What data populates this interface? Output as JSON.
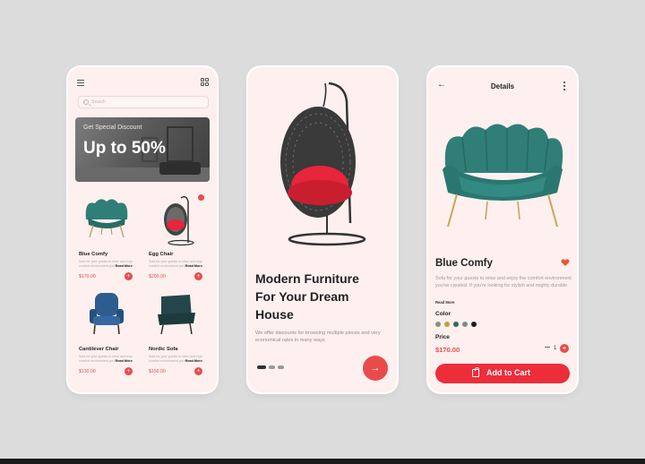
{
  "screen1": {
    "search": {
      "placeholder": "Search"
    },
    "banner": {
      "subtitle": "Get Special Discount",
      "headline": "Up to 50%"
    },
    "products": [
      {
        "name": "Blue Comfy",
        "desc_line1": "Sofa for your guests to relax and enjoy",
        "desc_line2": "comfort environment you've created",
        "read_more": "Read More",
        "price": "$170.00"
      },
      {
        "name": "Egg Chair",
        "desc_line1": "Sofa for your guests to relax and enjoy",
        "desc_line2": "comfort environment you've created",
        "read_more": "Read More",
        "price": "$200.00"
      },
      {
        "name": "Cantilever Chair",
        "desc_line1": "Sofa for your guests to relax and enjoy",
        "desc_line2": "comfort environment you've created",
        "read_more": "Read More",
        "price": "$130.00"
      },
      {
        "name": "Nordic Sofa",
        "desc_line1": "Sofa for your guests to relax and enjoy",
        "desc_line2": "comfort environment you've created",
        "read_more": "Read More",
        "price": "$150.00"
      }
    ],
    "plus_symbol": "+"
  },
  "screen2": {
    "title_line1": "Modern Furniture",
    "title_line2": "For Your Dream",
    "title_line3": "House",
    "description": "We offer discounts for browsing multiple pieces and very economical rates in many ways",
    "next_symbol": "→",
    "pager": {
      "count": 3,
      "active": 1
    }
  },
  "screen3": {
    "header_title": "Details",
    "back_symbol": "←",
    "product_name": "Blue Comfy",
    "description": "Sofa for your guests to relax and enjoy the comfort environment you've created. If you're looking for stylish and mighty durable",
    "read_more": "Read More",
    "color_label": "Color",
    "colors": [
      "#8a8e7c",
      "#b5a63c",
      "#2d6a63",
      "#7f8b8a",
      "#1c1c1c"
    ],
    "price_label": "Price",
    "price": "$170.00",
    "quantity": "1",
    "qty_plus_symbol": "+",
    "add_to_cart": "Add to Cart"
  },
  "colors": {
    "accent": "#e94b4b",
    "cart_button": "#ee2d3a",
    "card_bg": "#fdf0ef",
    "teal": "#2f7f78"
  }
}
